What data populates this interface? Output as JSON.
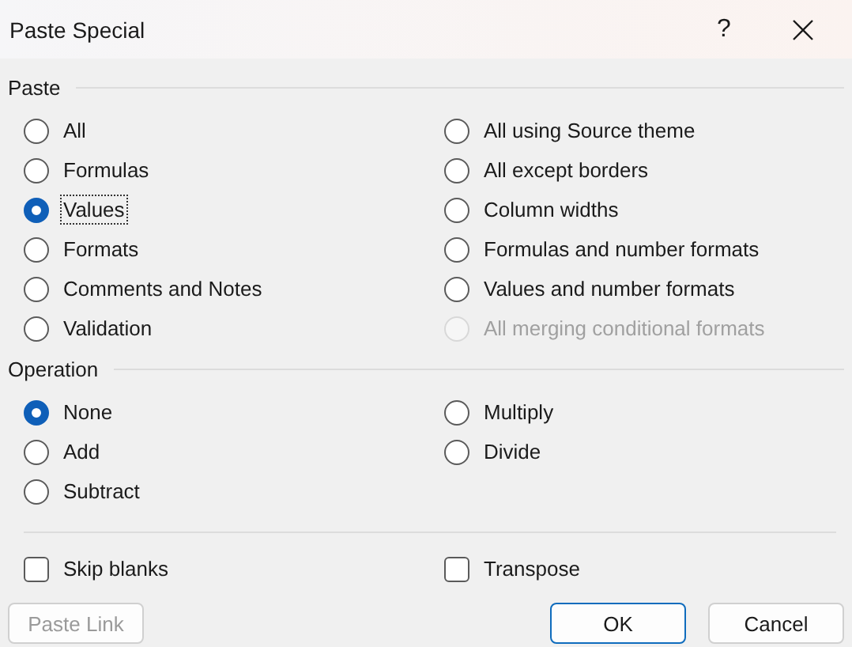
{
  "window": {
    "title": "Paste Special",
    "help": "?"
  },
  "paste": {
    "label": "Paste",
    "columns": [
      [
        {
          "label": "All",
          "selected": false,
          "focused": false,
          "disabled": false
        },
        {
          "label": "Formulas",
          "selected": false,
          "focused": false,
          "disabled": false
        },
        {
          "label": "Values",
          "selected": true,
          "focused": true,
          "disabled": false
        },
        {
          "label": "Formats",
          "selected": false,
          "focused": false,
          "disabled": false
        },
        {
          "label": "Comments and Notes",
          "selected": false,
          "focused": false,
          "disabled": false
        },
        {
          "label": "Validation",
          "selected": false,
          "focused": false,
          "disabled": false
        }
      ],
      [
        {
          "label": "All using Source theme",
          "selected": false,
          "focused": false,
          "disabled": false
        },
        {
          "label": "All except borders",
          "selected": false,
          "focused": false,
          "disabled": false
        },
        {
          "label": "Column widths",
          "selected": false,
          "focused": false,
          "disabled": false
        },
        {
          "label": "Formulas and number formats",
          "selected": false,
          "focused": false,
          "disabled": false
        },
        {
          "label": "Values and number formats",
          "selected": false,
          "focused": false,
          "disabled": false
        },
        {
          "label": "All merging conditional formats",
          "selected": false,
          "focused": false,
          "disabled": true
        }
      ]
    ]
  },
  "operation": {
    "label": "Operation",
    "columns": [
      [
        {
          "label": "None",
          "selected": true,
          "focused": false,
          "disabled": false
        },
        {
          "label": "Add",
          "selected": false,
          "focused": false,
          "disabled": false
        },
        {
          "label": "Subtract",
          "selected": false,
          "focused": false,
          "disabled": false
        }
      ],
      [
        {
          "label": "Multiply",
          "selected": false,
          "focused": false,
          "disabled": false
        },
        {
          "label": "Divide",
          "selected": false,
          "focused": false,
          "disabled": false
        }
      ]
    ]
  },
  "options": [
    {
      "label": "Skip blanks",
      "checked": false
    },
    {
      "label": "Transpose",
      "checked": false
    }
  ],
  "buttons": [
    {
      "label": "Paste Link",
      "kind": "secondary",
      "disabled": true
    },
    {
      "label": "OK",
      "kind": "default",
      "disabled": false
    },
    {
      "label": "Cancel",
      "kind": "secondary",
      "disabled": false
    }
  ]
}
